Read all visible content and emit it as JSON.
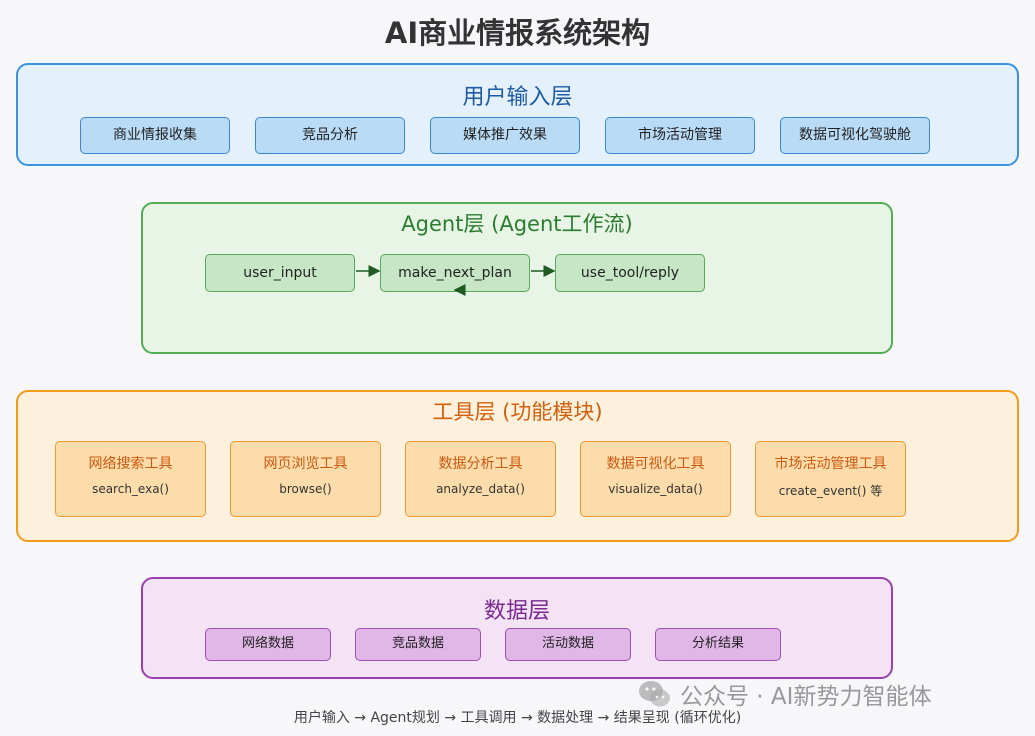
{
  "title": "AI商业情报系统架构",
  "user_layer": {
    "title": "用户输入层",
    "items": [
      "商业情报收集",
      "竞品分析",
      "媒体推广效果",
      "市场活动管理",
      "数据可视化驾驶舱"
    ]
  },
  "agent_layer": {
    "title": "Agent层 (Agent工作流)",
    "nodes": [
      "user_input",
      "make_next_plan",
      "use_tool/reply"
    ]
  },
  "tool_layer": {
    "title": "工具层 (功能模块)",
    "tools": [
      {
        "name": "网络搜索工具",
        "func": "search_exa()"
      },
      {
        "name": "网页浏览工具",
        "func": "browse()"
      },
      {
        "name": "数据分析工具",
        "func": "analyze_data()"
      },
      {
        "name": "数据可视化工具",
        "func": "visualize_data()"
      },
      {
        "name": "市场活动管理工具",
        "func": "create_event() 等"
      }
    ]
  },
  "data_layer": {
    "title": "数据层",
    "items": [
      "网络数据",
      "竞品数据",
      "活动数据",
      "分析结果"
    ]
  },
  "footer": "用户输入 → Agent规划 → 工具调用 → 数据处理 → 结果呈现 (循环优化)",
  "watermark": {
    "text": "公众号 · AI新势力智能体",
    "icon": "wechat-icon"
  },
  "colors": {
    "user": "#3a93df",
    "agent": "#53ad56",
    "tool": "#f39b1b",
    "data": "#9c3db0"
  }
}
